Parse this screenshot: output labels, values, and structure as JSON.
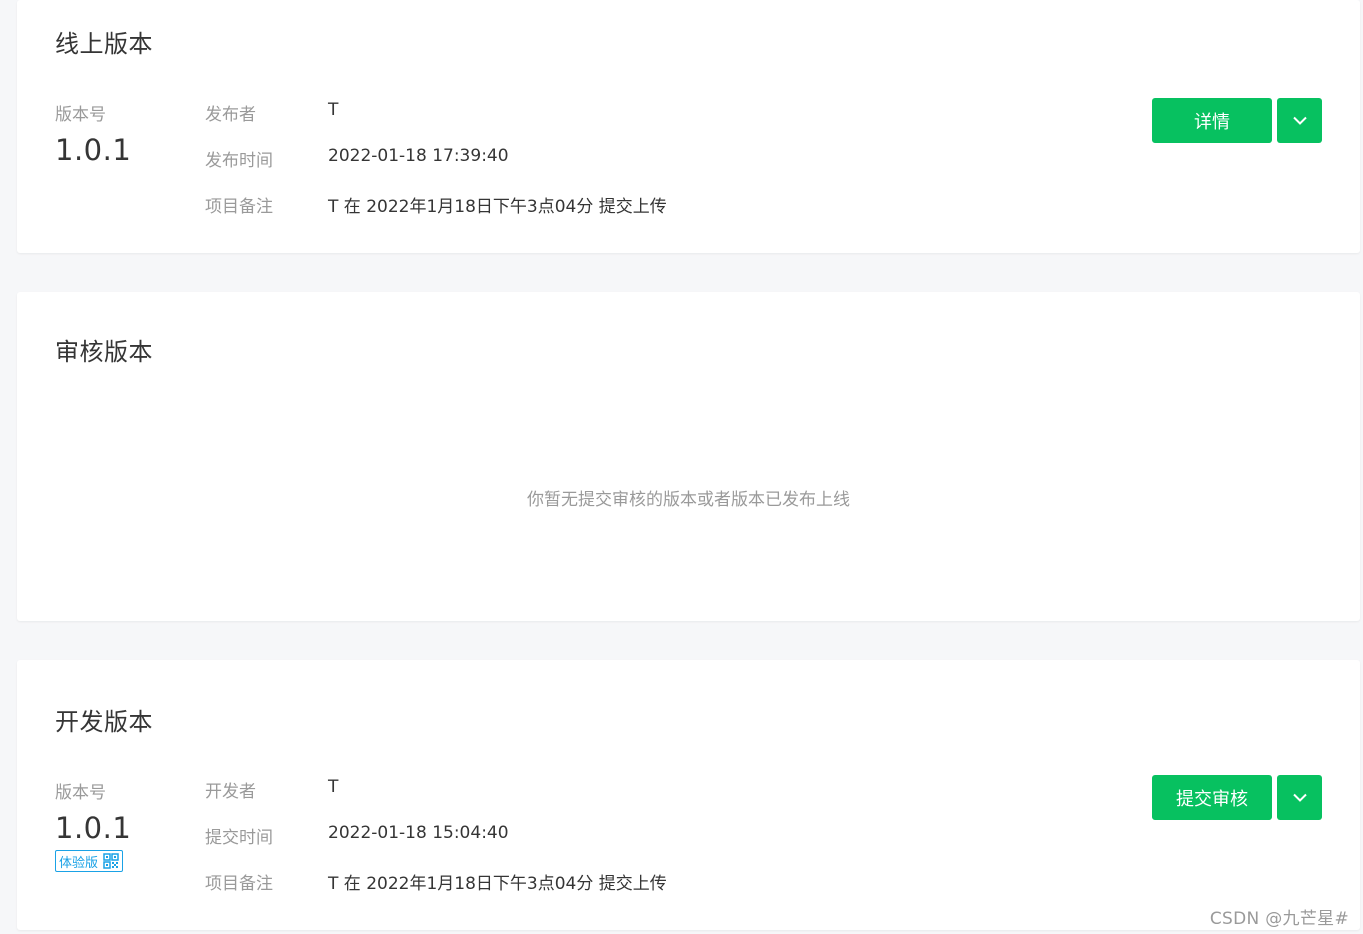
{
  "online": {
    "title": "线上版本",
    "version_label": "版本号",
    "version": "1.0.1",
    "rows": [
      {
        "key": "发布者",
        "value": "T"
      },
      {
        "key": "发布时间",
        "value": "2022-01-18 17:39:40"
      },
      {
        "key": "项目备注",
        "value": "T 在 2022年1月18日下午3点04分 提交上传"
      }
    ],
    "primary_button": "详情",
    "dropdown_icon": "chevron-down-icon"
  },
  "review": {
    "title": "审核版本",
    "empty_message": "你暂无提交审核的版本或者版本已发布上线"
  },
  "dev": {
    "title": "开发版本",
    "version_label": "版本号",
    "version": "1.0.1",
    "badge": "体验版",
    "badge_icon": "qrcode-icon",
    "rows": [
      {
        "key": "开发者",
        "value": "T"
      },
      {
        "key": "提交时间",
        "value": "2022-01-18 15:04:40"
      },
      {
        "key": "项目备注",
        "value": "T 在 2022年1月18日下午3点04分 提交上传"
      }
    ],
    "primary_button": "提交审核",
    "dropdown_icon": "chevron-down-icon"
  },
  "watermark": "CSDN @九芒星#",
  "colors": {
    "accent_green": "#07c160",
    "badge_blue": "#1aa2e6",
    "muted_text": "#9a9a9a",
    "main_text": "#353535",
    "page_background": "#f6f7f9"
  }
}
